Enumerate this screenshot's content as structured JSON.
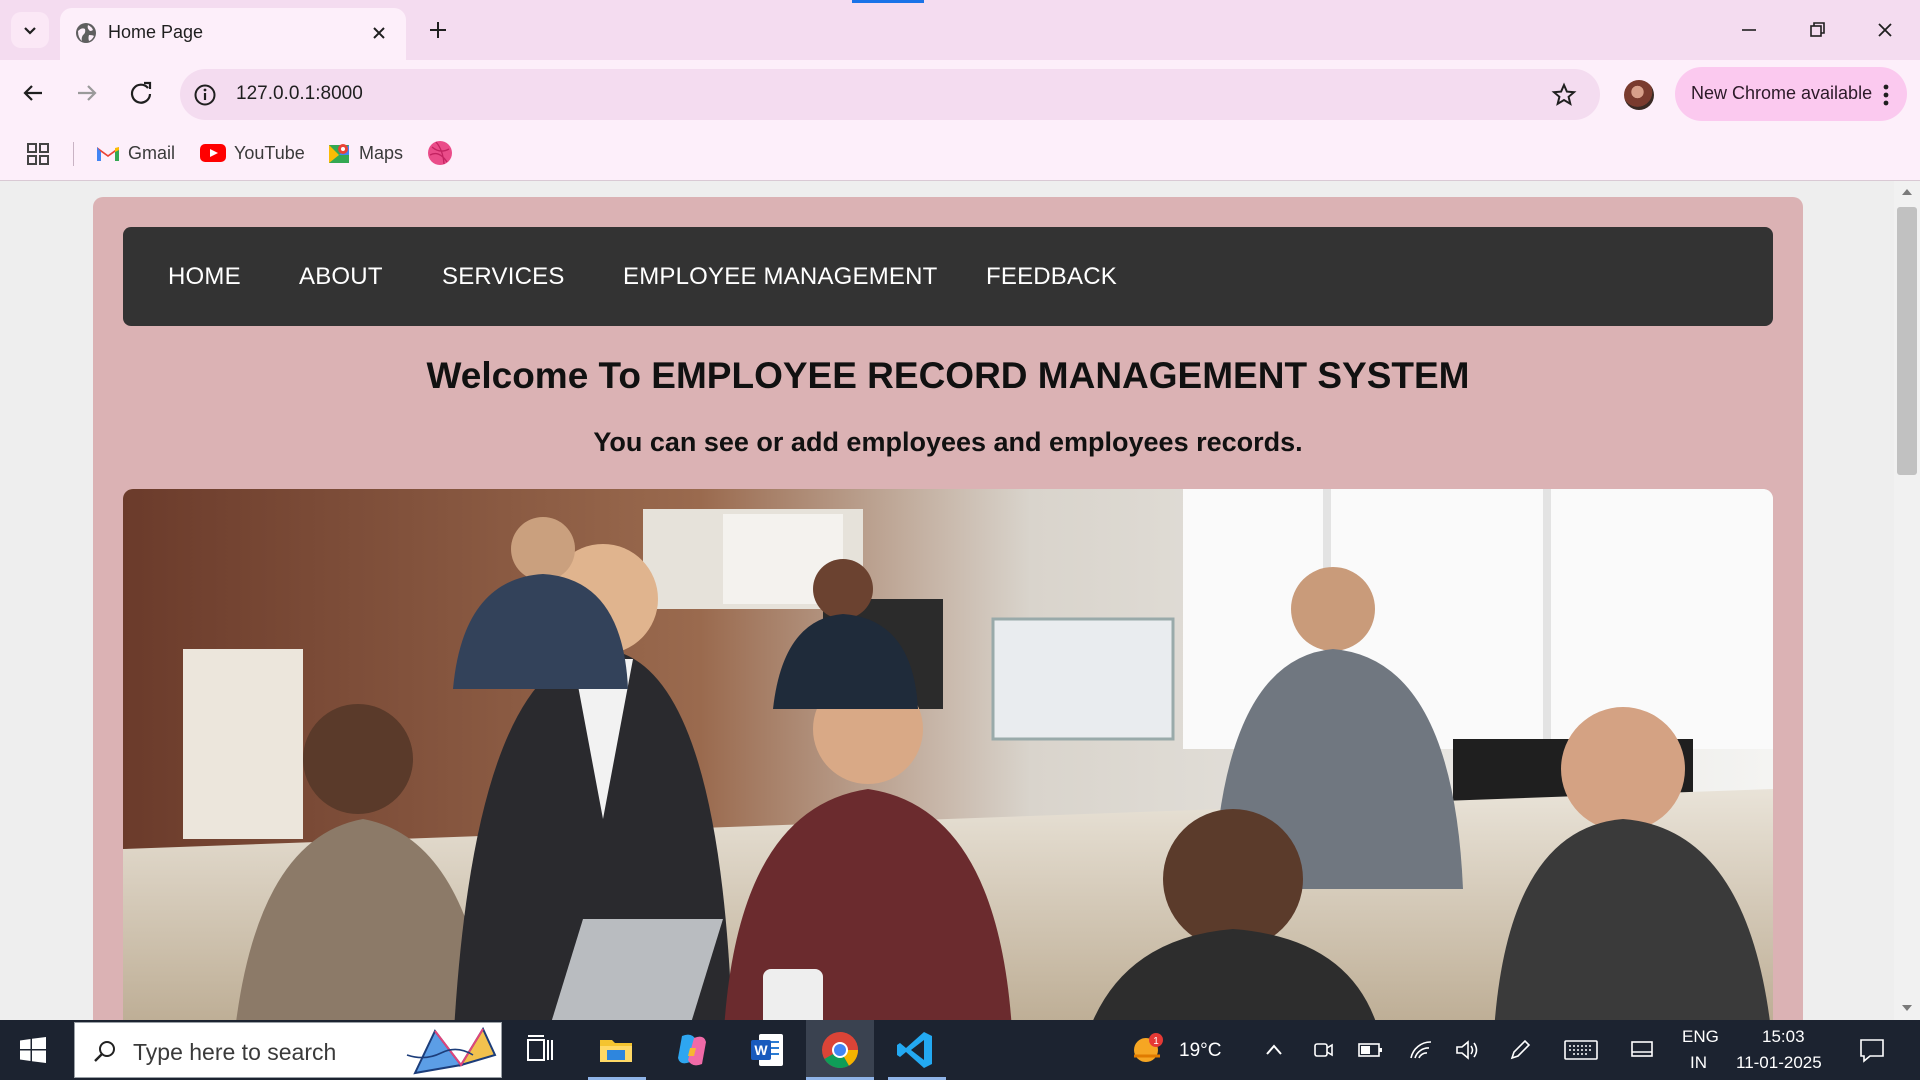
{
  "browser": {
    "tab": {
      "title": "Home Page"
    },
    "omnibox": {
      "url": "127.0.0.1:8000"
    },
    "update_chip": {
      "label": "New Chrome available"
    },
    "bookmarks": [
      {
        "label": "Gmail",
        "icon": "gmail-icon"
      },
      {
        "label": "YouTube",
        "icon": "youtube-icon"
      },
      {
        "label": "Maps",
        "icon": "maps-icon"
      },
      {
        "label": "",
        "icon": "dribbble-icon"
      }
    ]
  },
  "page": {
    "nav": {
      "items": [
        "HOME",
        "ABOUT",
        "SERVICES",
        "EMPLOYEE MANAGEMENT",
        "FEEDBACK"
      ]
    },
    "title": "Welcome To EMPLOYEE RECORD MANAGEMENT SYSTEM",
    "subtitle": "You can see or add employees and employees records.",
    "hero_image": "office team photo"
  },
  "taskbar": {
    "search_placeholder": "Type here to search",
    "weather": {
      "temp": "19°C",
      "badge": "1"
    },
    "language": {
      "line1": "ENG",
      "line2": "IN"
    },
    "clock": {
      "time": "15:03",
      "date": "11-01-2025"
    }
  },
  "colors": {
    "tabstrip": "#f4dcf0",
    "toolbar": "#fdeffa",
    "page_container": "#dbb2b4",
    "nav_bg": "#333333",
    "taskbar": "#1c2330"
  }
}
